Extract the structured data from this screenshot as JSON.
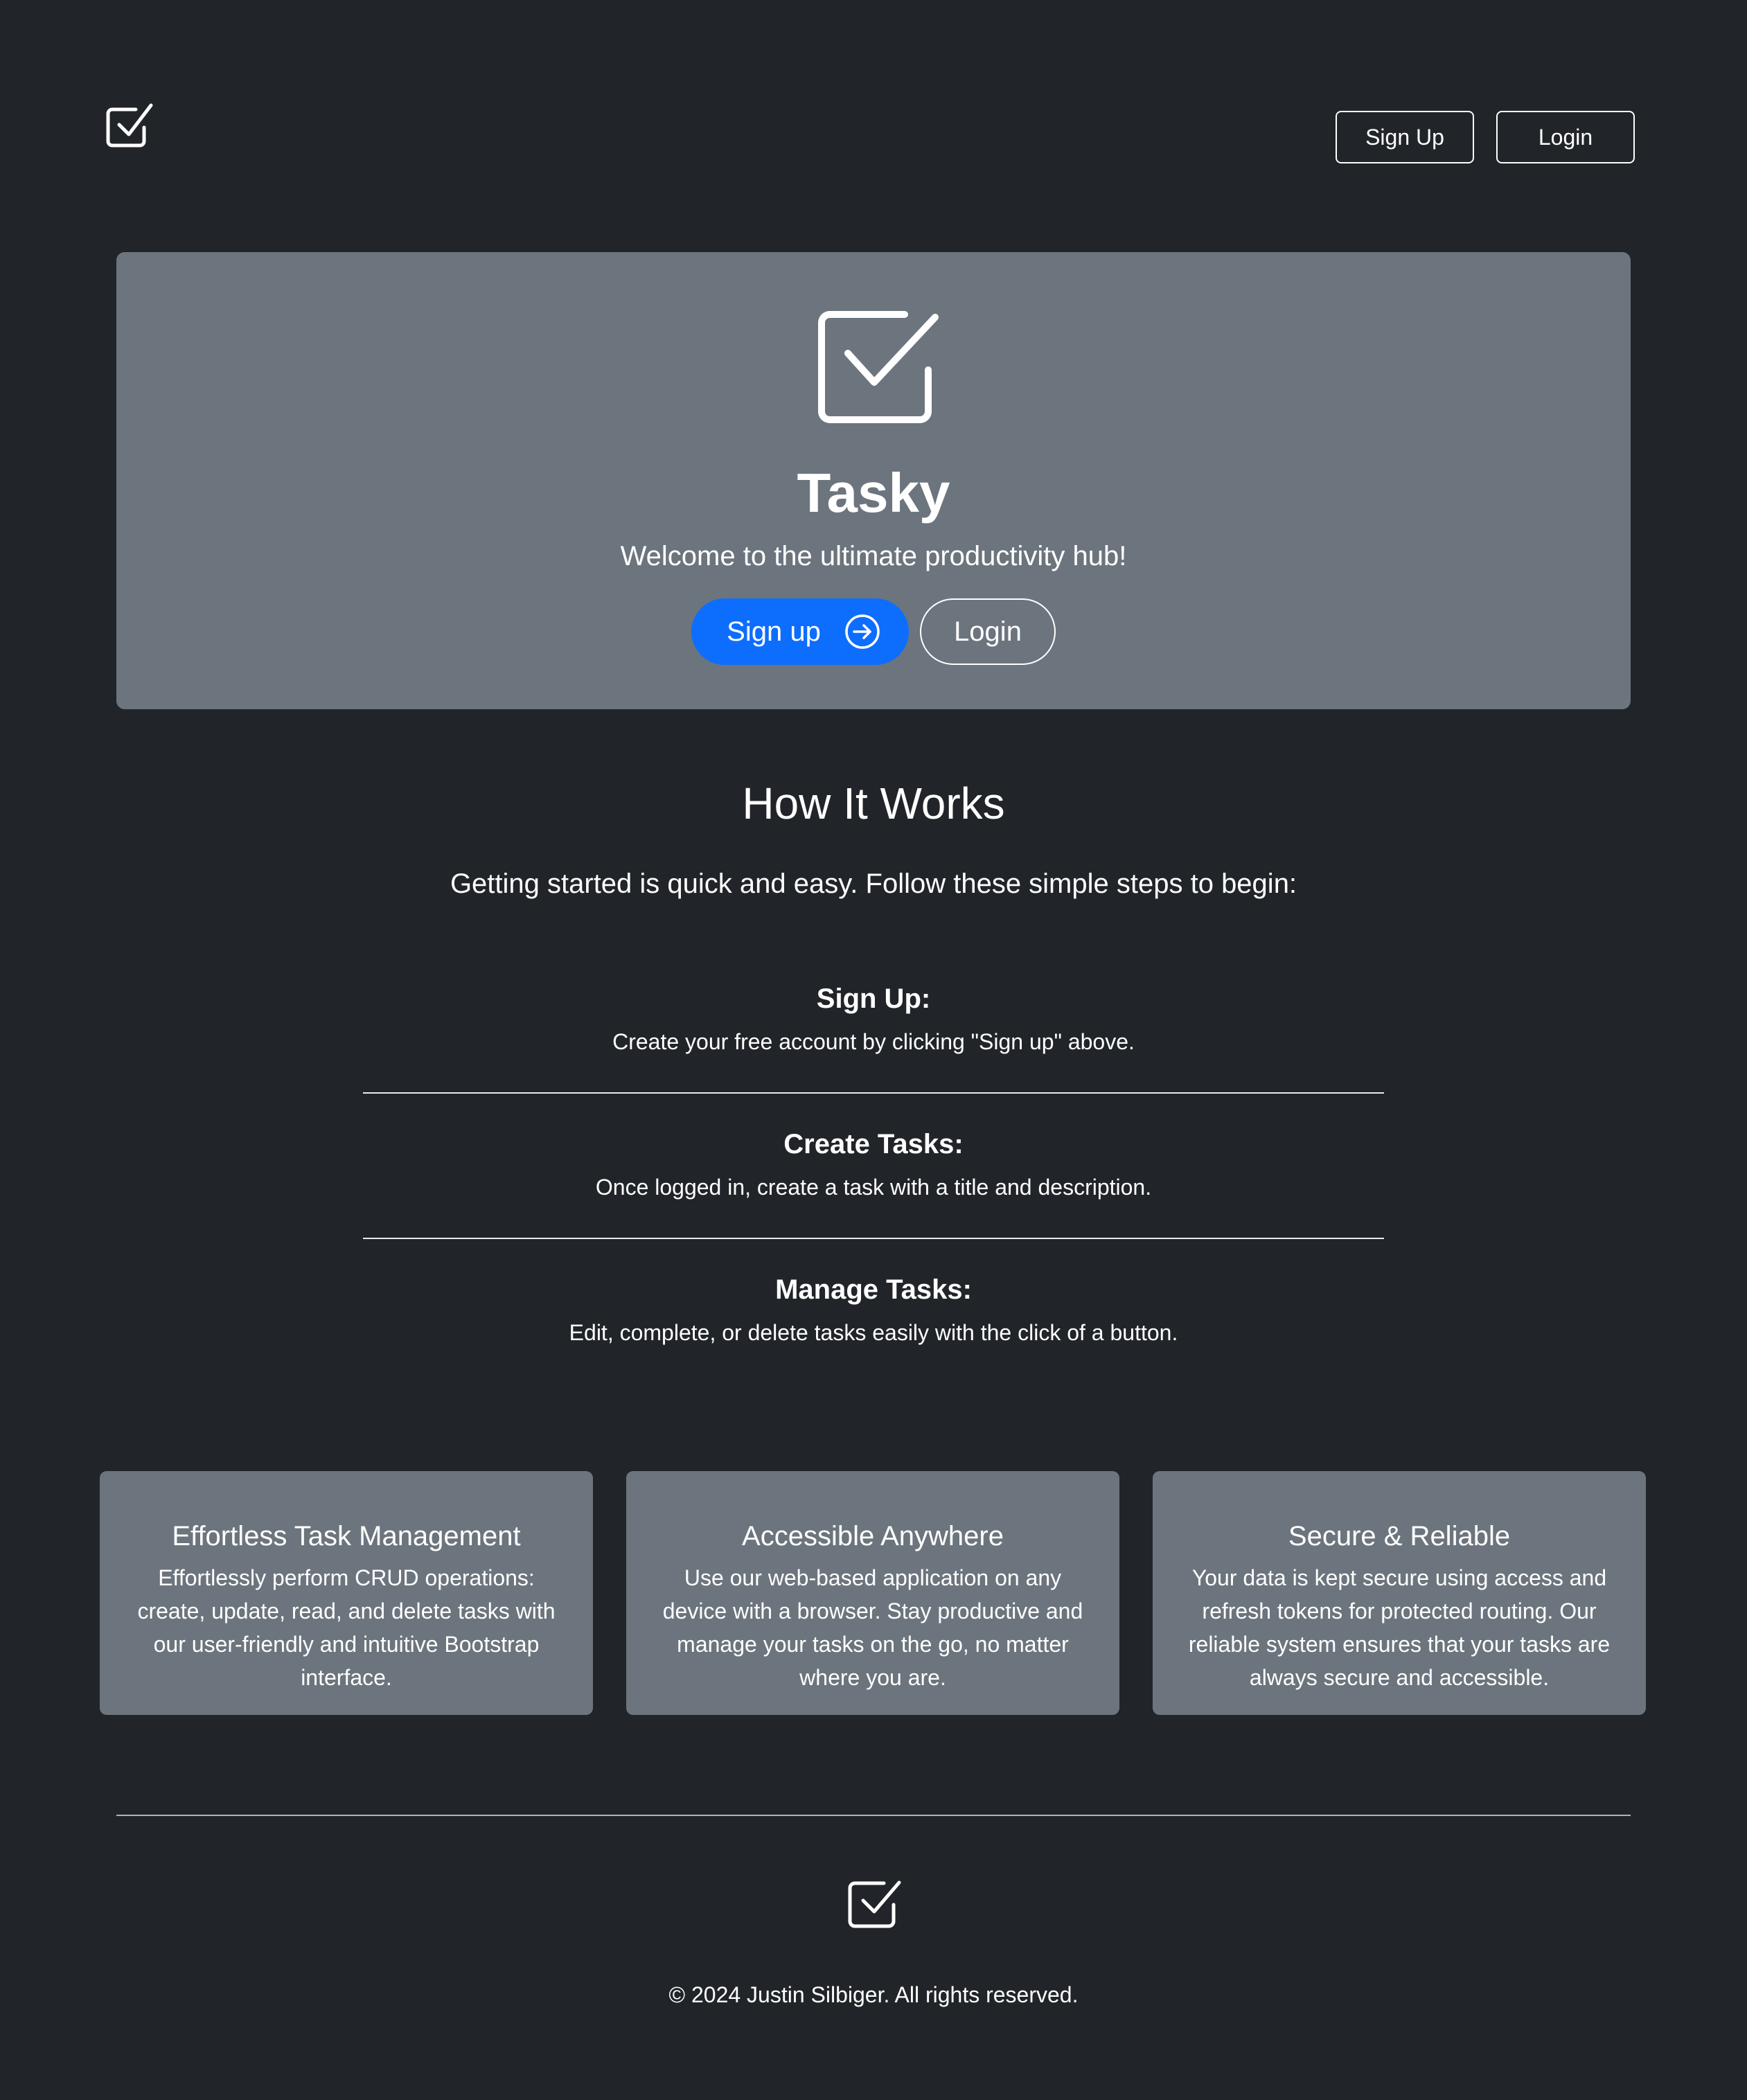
{
  "header": {
    "logo_icon": "check-square-icon",
    "signup_label": "Sign Up",
    "login_label": "Login"
  },
  "hero": {
    "icon": "check-square-icon",
    "title": "Tasky",
    "subtitle": "Welcome to the ultimate productivity hub!",
    "signup_label": "Sign up",
    "signup_icon": "arrow-right-circle-icon",
    "login_label": "Login",
    "accent_color": "#0d6efd"
  },
  "how": {
    "title": "How It Works",
    "lead": "Getting started is quick and easy. Follow these simple steps to begin:",
    "steps": [
      {
        "title": "Sign Up:",
        "desc": "Create your free account by clicking \"Sign up\" above."
      },
      {
        "title": "Create Tasks:",
        "desc": "Once logged in, create a task with a title and description."
      },
      {
        "title": "Manage Tasks:",
        "desc": "Edit, complete, or delete tasks easily with the click of a button."
      }
    ]
  },
  "features": [
    {
      "title": "Effortless Task Management",
      "text": "Effortlessly perform CRUD operations: create, update, read, and delete tasks with our user-friendly and intuitive Bootstrap interface."
    },
    {
      "title": "Accessible Anywhere",
      "text": "Use our web-based application on any device with a browser. Stay productive and manage your tasks on the go, no matter where you are."
    },
    {
      "title": "Secure & Reliable",
      "text": "Your data is kept secure using access and refresh tokens for protected routing. Our reliable system ensures that your tasks are always secure and accessible."
    }
  ],
  "footer": {
    "icon": "check-square-icon",
    "copyright": "© 2024 Justin Silbiger. All rights reserved."
  },
  "colors": {
    "background": "#212529",
    "panel": "#6c757d",
    "text": "#ffffff"
  }
}
